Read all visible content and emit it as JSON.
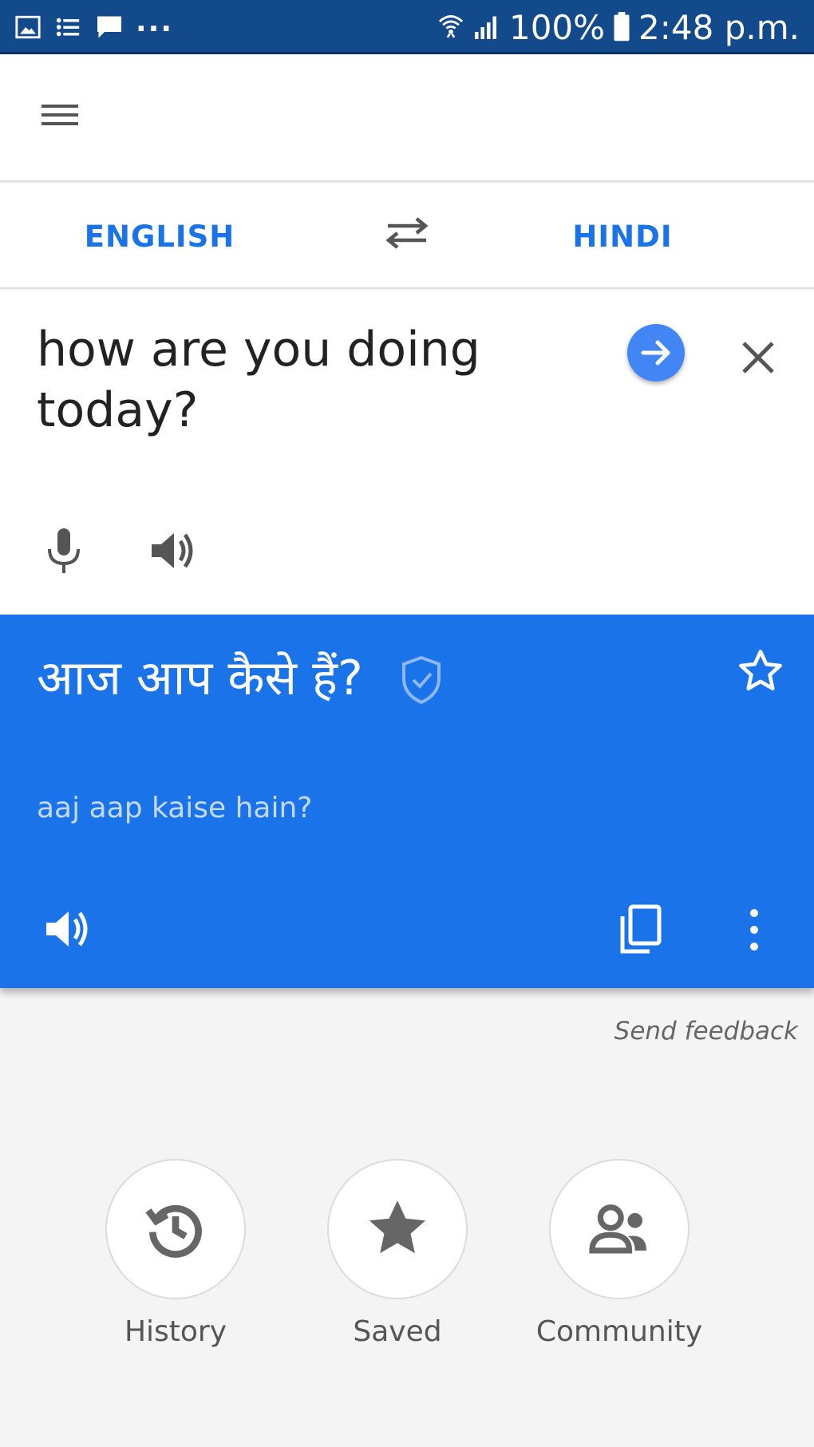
{
  "status_bar": {
    "battery": "100%",
    "time": "2:48 p.m.",
    "more_indicator": "..."
  },
  "language_bar": {
    "source": "ENGLISH",
    "target": "HINDI"
  },
  "input": {
    "text": "how are you doing today?"
  },
  "result": {
    "translation": "आज आप कैसे हैं?",
    "transliteration": "aaj aap kaise hain?"
  },
  "footer": {
    "feedback": "Send feedback"
  },
  "shortcuts": [
    {
      "label": "History",
      "icon": "history-icon"
    },
    {
      "label": "Saved",
      "icon": "star-icon"
    },
    {
      "label": "Community",
      "icon": "community-icon"
    }
  ],
  "colors": {
    "status_bar": "#134a8c",
    "accent": "#1a73e8",
    "go_button": "#4285f4",
    "background": "#f4f4f4"
  }
}
